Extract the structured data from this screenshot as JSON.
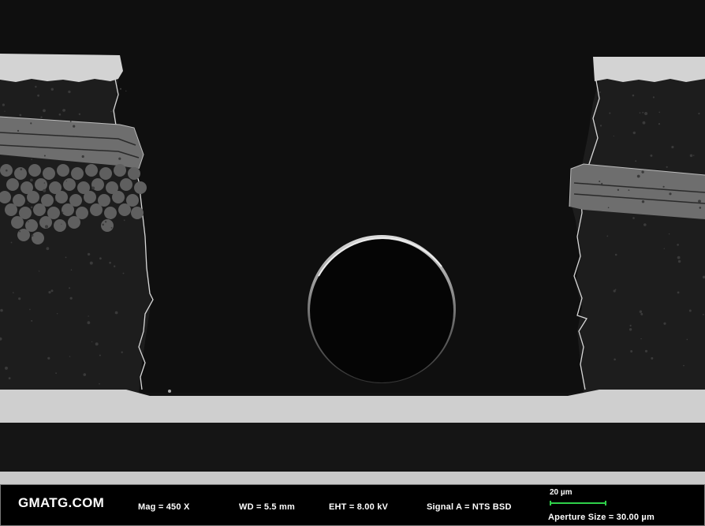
{
  "image": {
    "type": "SEM cross-section micrograph",
    "colors": {
      "background": "#0f0f0f",
      "copper_layer": "#cfcfcf",
      "laminate": "#1d1d1d",
      "fiber": "#6a6a6a",
      "scale_bar": "#2fd04a"
    }
  },
  "info_bar": {
    "brand": "GMATG.COM",
    "mag": "Mag =    450 X",
    "wd": "WD =  5.5 mm",
    "eht": "EHT =  8.00 kV",
    "signal": "Signal A = NTS BSD",
    "scale_label": "20 µm",
    "aperture": "Aperture Size = 30.00 µm"
  }
}
